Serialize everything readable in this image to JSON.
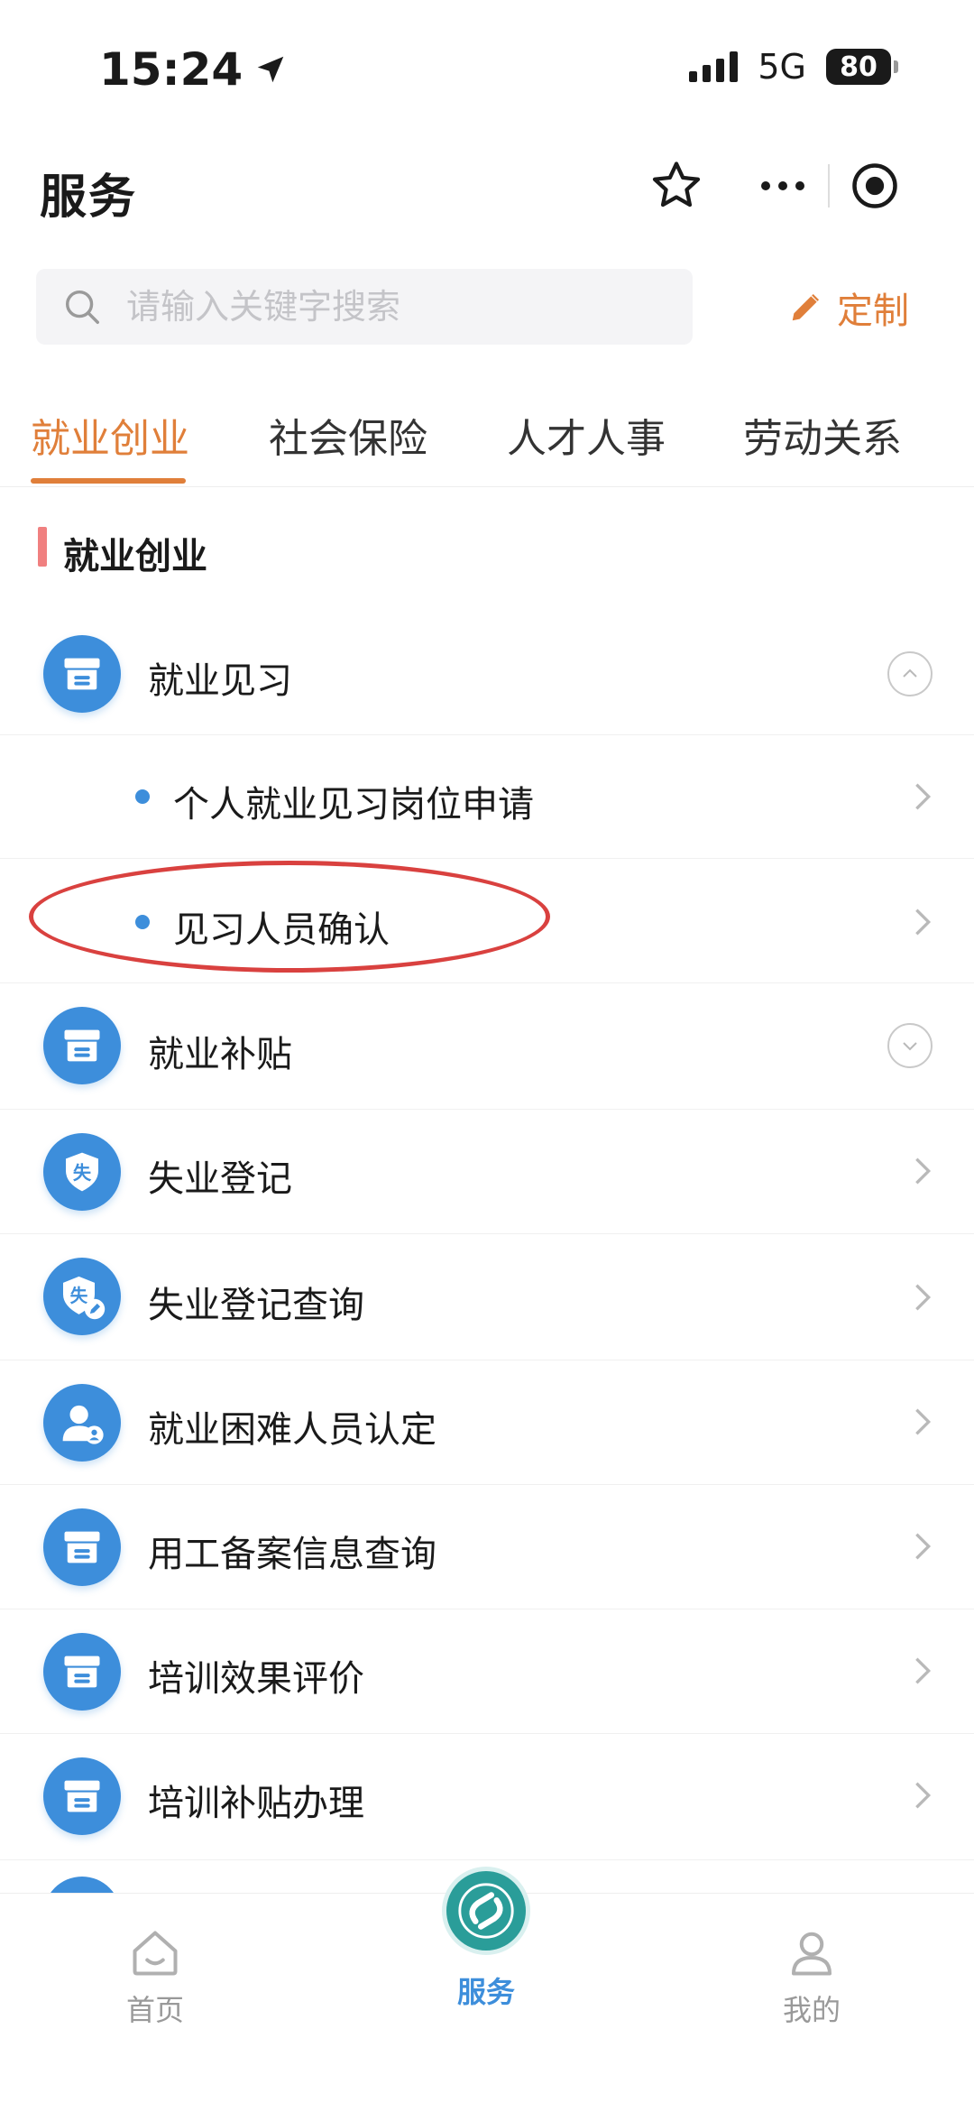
{
  "status_bar": {
    "time": "15:24",
    "network": "5G",
    "battery": "80"
  },
  "header": {
    "title": "服务"
  },
  "search": {
    "placeholder": "请输入关键字搜索",
    "custom_label": "定制"
  },
  "tabs": [
    {
      "label": "就业创业",
      "active": true
    },
    {
      "label": "社会保险",
      "active": false
    },
    {
      "label": "人才人事",
      "active": false
    },
    {
      "label": "劳动关系",
      "active": false
    }
  ],
  "section": {
    "title": "就业创业"
  },
  "items": [
    {
      "label": "就业见习",
      "icon": "box-icon",
      "state": "expanded"
    },
    {
      "label": "个人就业见习岗位申请",
      "sub": true
    },
    {
      "label": "见习人员确认",
      "sub": true,
      "highlighted": true
    },
    {
      "label": "就业补贴",
      "icon": "box-icon",
      "state": "collapsed"
    },
    {
      "label": "失业登记",
      "icon": "shield-shi-icon"
    },
    {
      "label": "失业登记查询",
      "icon": "shield-shi-edit-icon"
    },
    {
      "label": "就业困难人员认定",
      "icon": "user-icon"
    },
    {
      "label": "用工备案信息查询",
      "icon": "box-icon"
    },
    {
      "label": "培训效果评价",
      "icon": "box-icon"
    },
    {
      "label": "培训补贴办理",
      "icon": "box-icon"
    }
  ],
  "bottom_nav": [
    {
      "label": "首页",
      "icon": "home-icon",
      "active": false
    },
    {
      "label": "服务",
      "icon": "service-logo-icon",
      "active": true
    },
    {
      "label": "我的",
      "icon": "profile-icon",
      "active": false
    }
  ],
  "colors": {
    "accent": "#e07f3a",
    "primary": "#3d8edb",
    "highlight": "#d9413f"
  }
}
